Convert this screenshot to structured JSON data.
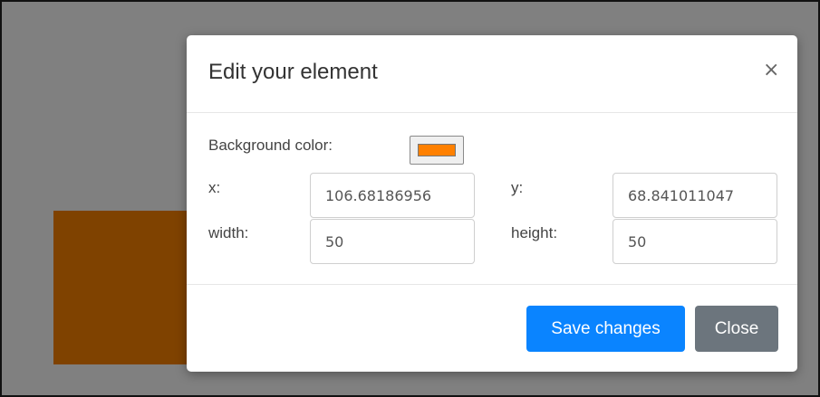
{
  "modal": {
    "title": "Edit your element",
    "close_symbol": "×"
  },
  "form": {
    "background_label": "Background color:",
    "background_value": "#ff8000",
    "x_label": "x:",
    "x_value": "106.68186956",
    "y_label": "y:",
    "y_value": "68.841011047",
    "width_label": "width:",
    "width_value": "50",
    "height_label": "height:",
    "height_value": "50"
  },
  "footer": {
    "save_label": "Save changes",
    "close_label": "Close"
  },
  "colors": {
    "backdrop": "#808080",
    "element": "#7f4200",
    "primary": "#0a84ff",
    "secondary": "#6c757d"
  },
  "icons": {
    "close": "close-icon"
  }
}
